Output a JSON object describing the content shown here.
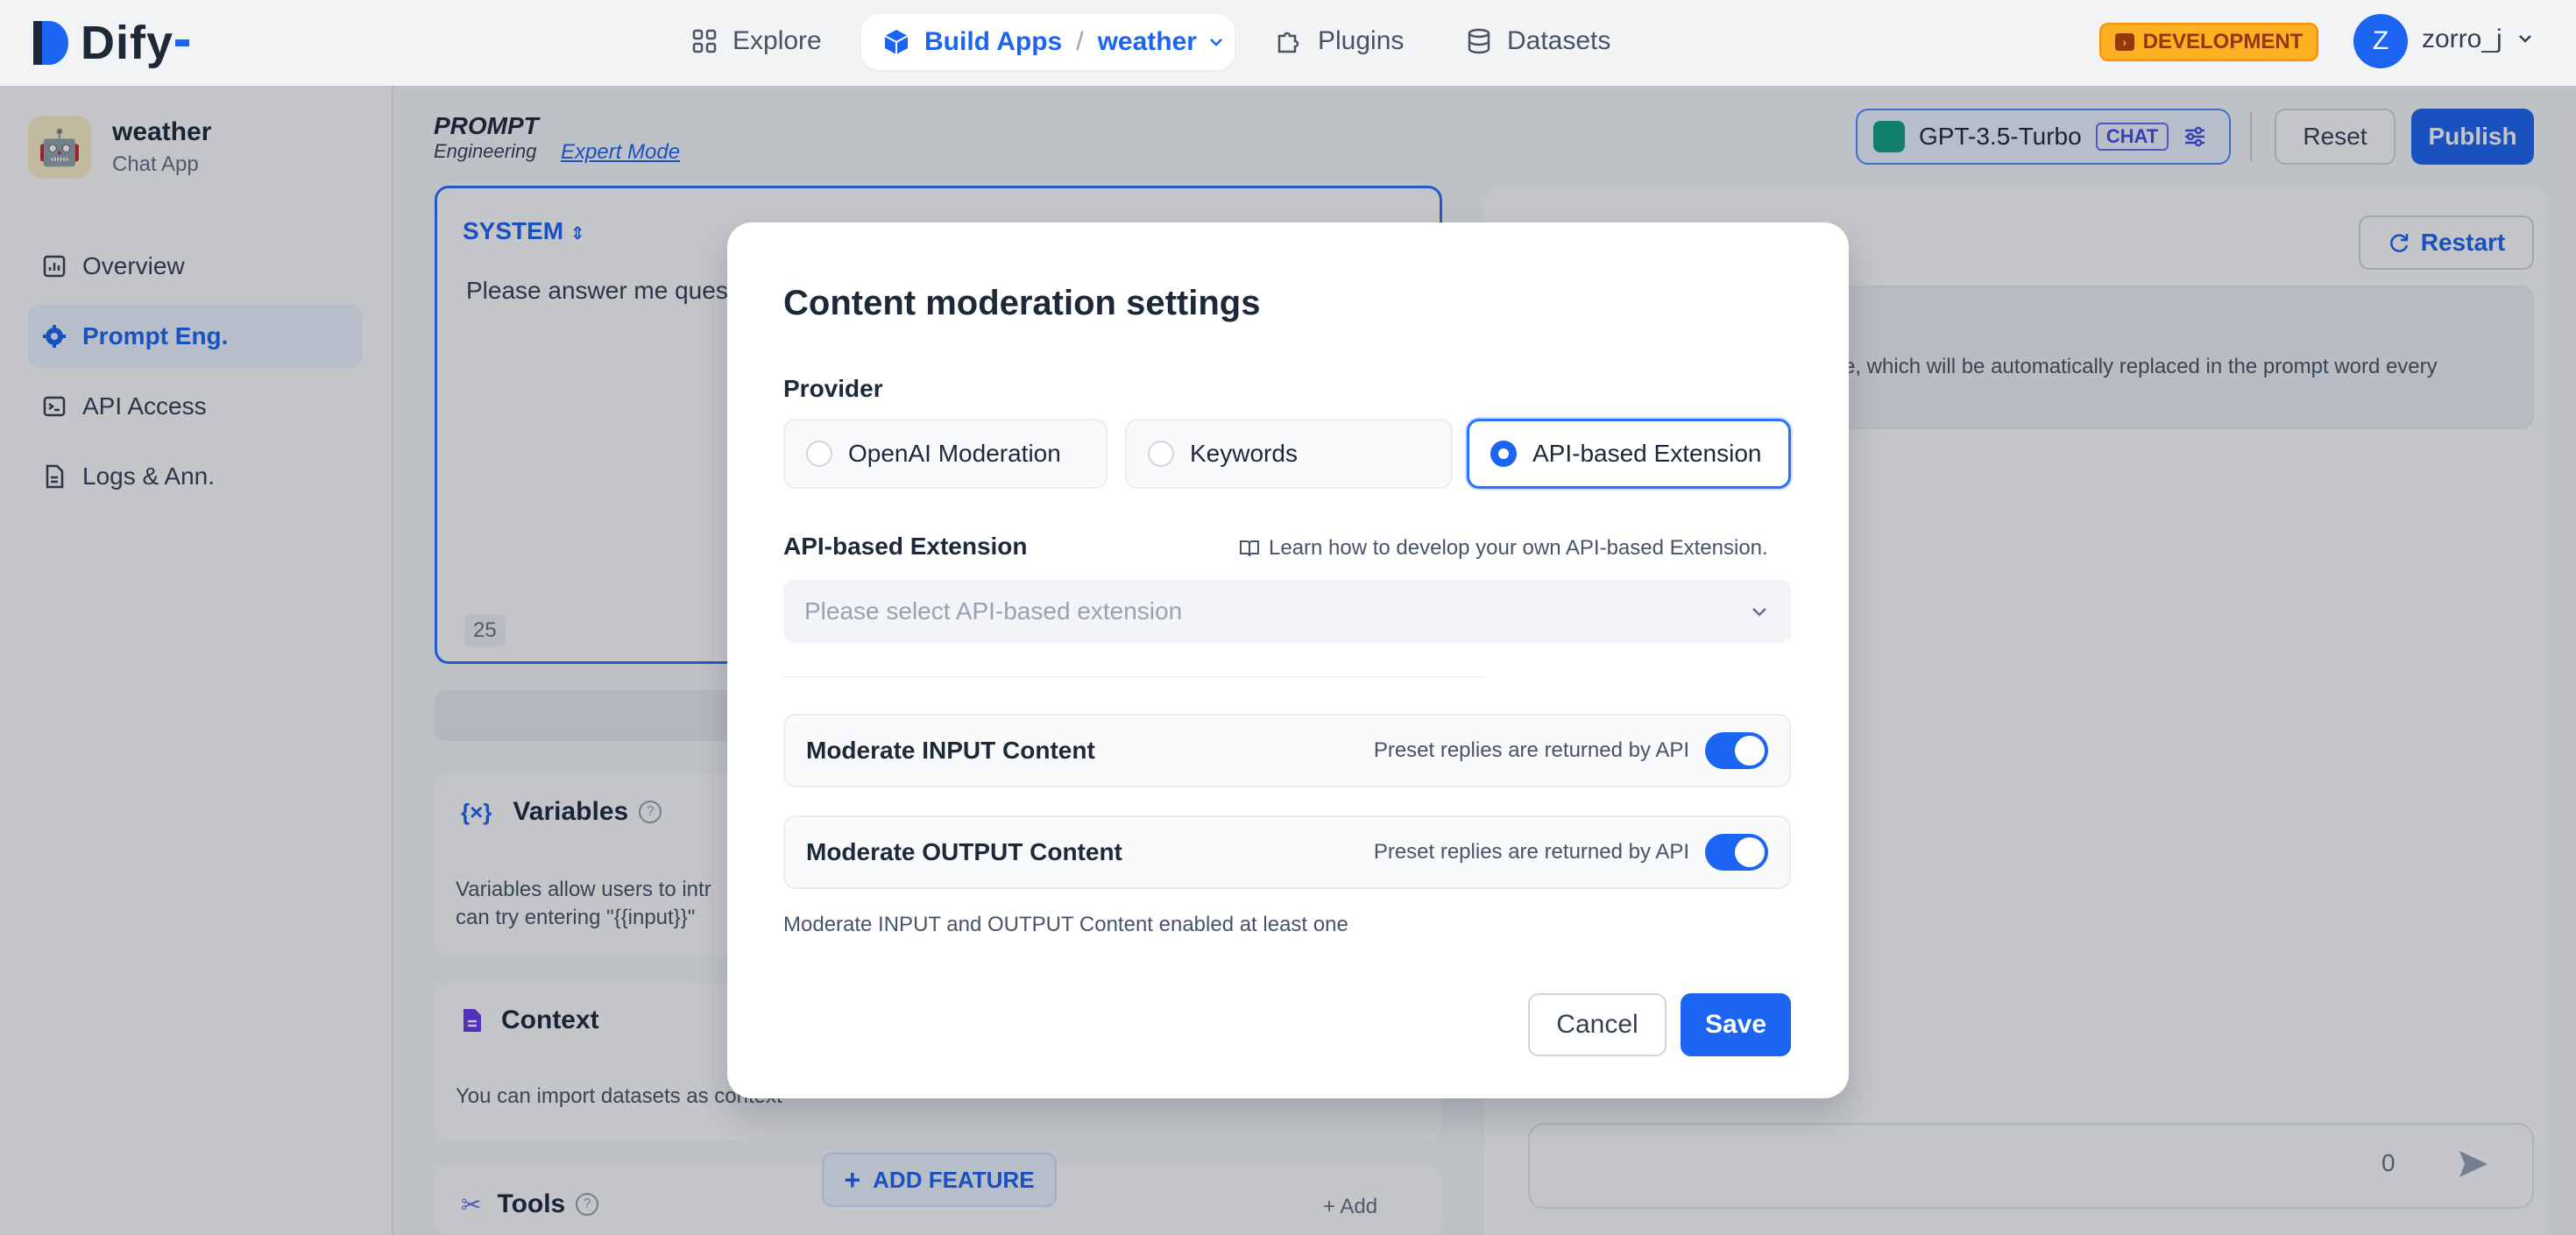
{
  "topbar": {
    "logo_text": "Dify",
    "nav": {
      "explore": "Explore",
      "build_apps": "Build Apps",
      "separator": "/",
      "current_app": "weather",
      "plugins": "Plugins",
      "datasets": "Datasets"
    },
    "env_badge": "DEVELOPMENT",
    "avatar_initial": "Z",
    "username": "zorro_j"
  },
  "sidebar": {
    "app_name": "weather",
    "app_type": "Chat App",
    "items": [
      {
        "label": "Overview",
        "icon": "chart-icon"
      },
      {
        "label": "Prompt Eng.",
        "icon": "gear-icon",
        "active": true
      },
      {
        "label": "API Access",
        "icon": "terminal-icon"
      },
      {
        "label": "Logs & Ann.",
        "icon": "document-icon"
      }
    ]
  },
  "main": {
    "prompt_title": "PROMPT",
    "prompt_subtitle": "Engineering",
    "expert_mode": "Expert Mode",
    "system_label": "SYSTEM",
    "system_text": "Please answer me ques",
    "char_count": "25",
    "variables_title": "Variables",
    "variables_desc_1": "Variables allow users to intr",
    "variables_desc_2": "can try entering \"{{input}}\"",
    "context_title": "Context",
    "context_desc": "You can import datasets as context",
    "tools_title": "Tools",
    "tools_add": "Add",
    "add_feature": "ADD FEATURE"
  },
  "header_right": {
    "model_name": "GPT-3.5-Turbo",
    "model_tag": "CHAT",
    "reset": "Reset",
    "publish": "Publish"
  },
  "debug": {
    "restart": "Restart",
    "opening_text_1": "e, which will be automatically replaced in the prompt word every",
    "opening_text_2": "",
    "chat_count": "0"
  },
  "modal": {
    "title": "Content moderation settings",
    "provider_label": "Provider",
    "providers": [
      {
        "label": "OpenAI Moderation",
        "selected": false
      },
      {
        "label": "Keywords",
        "selected": false
      },
      {
        "label": "API-based Extension",
        "selected": true
      }
    ],
    "extension_label": "API-based Extension",
    "learn_link": "Learn how to develop your own API-based Extension.",
    "select_placeholder": "Please select API-based extension",
    "input_row": {
      "label": "Moderate INPUT Content",
      "hint": "Preset replies are returned by API",
      "enabled": true
    },
    "output_row": {
      "label": "Moderate OUTPUT Content",
      "hint": "Preset replies are returned by API",
      "enabled": true
    },
    "footer_hint": "Moderate INPUT and OUTPUT Content enabled at least one",
    "cancel": "Cancel",
    "save": "Save"
  },
  "colors": {
    "accent": "#1c64f2",
    "badge": "#fdb022",
    "overlay": "rgba(16,24,40,0.25)"
  }
}
